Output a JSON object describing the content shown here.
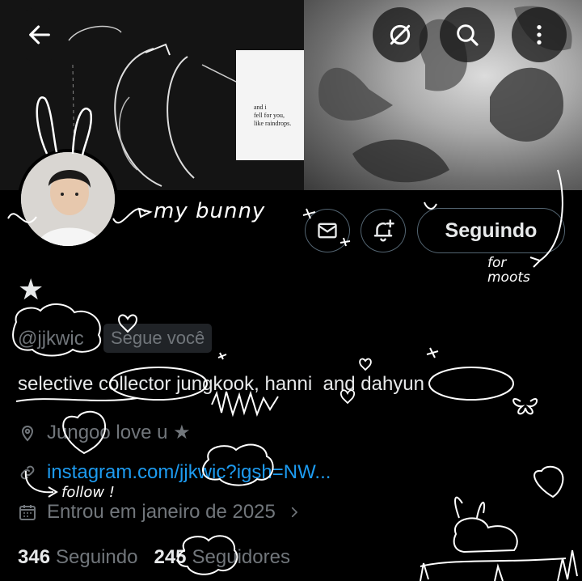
{
  "banner": {
    "note_text": "and i\nfell for you,\nlike raindrops."
  },
  "header_buttons": {
    "back_icon": "arrow-left-icon",
    "mute_icon": "mute-slash-icon",
    "search_icon": "search-icon",
    "more_icon": "more-vertical-icon"
  },
  "actions": {
    "message_icon": "envelope-icon",
    "notify_icon": "bell-plus-icon",
    "follow_label": "Seguindo"
  },
  "profile": {
    "name": "★",
    "handle": "@jjkwic",
    "follows_you": "Segue você",
    "bio": "selective collector jungkook, hanni  and dahyun",
    "location": "Jungoo love u ★",
    "link": "instagram.com/jjkwic?igsh=NW...",
    "joined": "Entrou em janeiro de 2025"
  },
  "stats": {
    "following_count": "346",
    "following_label": "Seguindo",
    "followers_count": "245",
    "followers_label": "Seguidores"
  },
  "doodles": {
    "bunny_text": "my bunny",
    "moots_text": "for\nmoots",
    "follow_text": "follow !"
  }
}
